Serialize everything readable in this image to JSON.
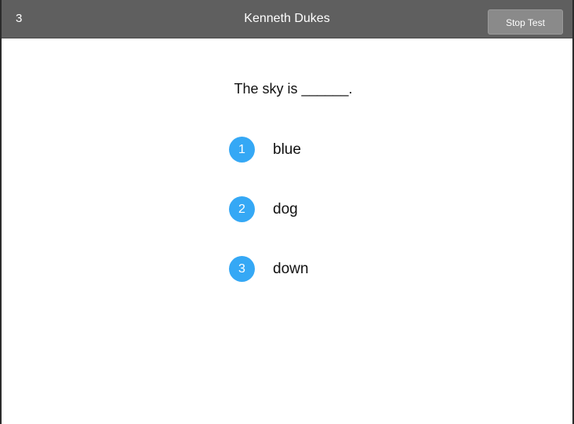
{
  "header": {
    "question_number": "3",
    "student_name": "Kenneth Dukes",
    "stop_test_label": "Stop Test"
  },
  "question": {
    "prompt": "The sky is ______."
  },
  "options": [
    {
      "number": "1",
      "label": "blue"
    },
    {
      "number": "2",
      "label": "dog"
    },
    {
      "number": "3",
      "label": "down"
    }
  ],
  "colors": {
    "header_bg": "#5f5f5f",
    "option_badge": "#35a8f5",
    "button_bg": "#8a8a8a"
  }
}
